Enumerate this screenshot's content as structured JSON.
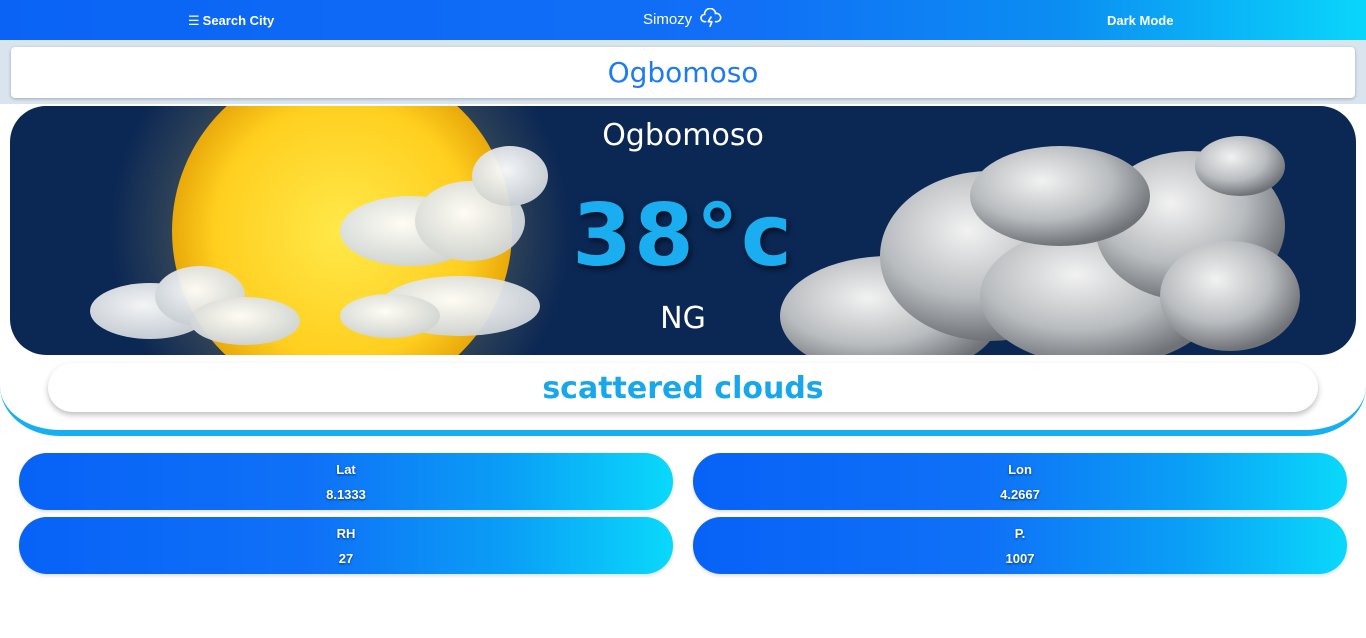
{
  "nav": {
    "search_label": "Search City",
    "brand": "Simozy",
    "dark_mode_label": "Dark Mode"
  },
  "search": {
    "value": "Ogbomoso"
  },
  "weather": {
    "city": "Ogbomoso",
    "temperature": "38°c",
    "country": "NG",
    "description": "scattered clouds"
  },
  "stats": {
    "lat": {
      "label": "Lat",
      "value": "8.1333"
    },
    "lon": {
      "label": "Lon",
      "value": "4.2667"
    },
    "rh": {
      "label": "RH",
      "value": "27"
    },
    "pressure": {
      "label": "P.",
      "value": "1007"
    }
  },
  "colors": {
    "accent": "#16b0f0",
    "nav_start": "#0a63f5",
    "nav_end": "#0ad6fb",
    "hero_bg": "#0b2754"
  },
  "icons": {
    "menu": "hamburger-icon",
    "brand": "cloud-lightning-icon"
  }
}
